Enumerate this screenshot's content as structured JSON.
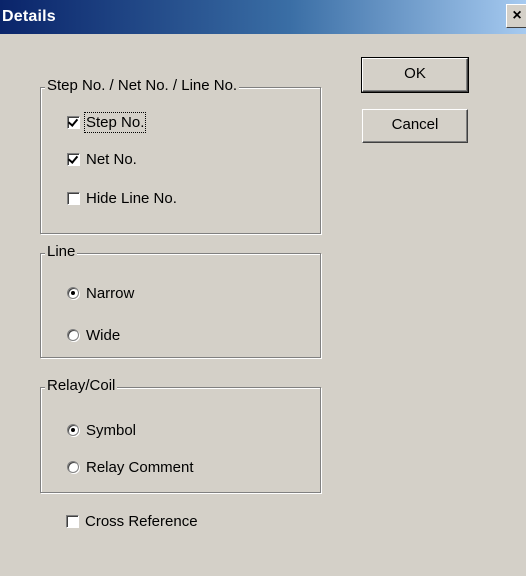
{
  "window": {
    "title": "Details",
    "close_glyph": "×"
  },
  "buttons": {
    "ok": "OK",
    "cancel": "Cancel"
  },
  "groups": {
    "step_net_line": {
      "legend": "Step No. / Net No. / Line No.",
      "options": [
        {
          "label": "Step No.",
          "checked": true
        },
        {
          "label": "Net No.",
          "checked": true
        },
        {
          "label": "Hide Line No.",
          "checked": false
        }
      ]
    },
    "line": {
      "legend": "Line",
      "options": [
        {
          "label": "Narrow",
          "selected": true
        },
        {
          "label": "Wide",
          "selected": false
        }
      ]
    },
    "relay_coil": {
      "legend": "Relay/Coil",
      "options": [
        {
          "label": "Symbol",
          "selected": true
        },
        {
          "label": "Relay Comment",
          "selected": false
        }
      ]
    }
  },
  "cross_reference": {
    "label": "Cross Reference",
    "checked": false
  }
}
